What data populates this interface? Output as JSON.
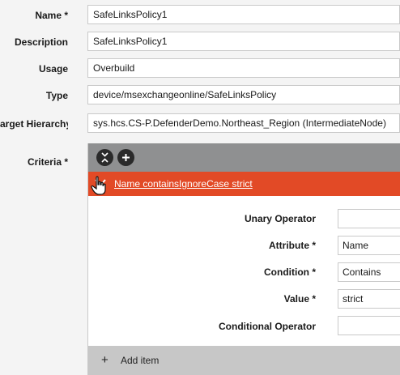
{
  "form": {
    "name": {
      "label": "Name *",
      "value": "SafeLinksPolicy1"
    },
    "description": {
      "label": "Description",
      "value": "SafeLinksPolicy1"
    },
    "usage": {
      "label": "Usage",
      "value": "Overbuild"
    },
    "type": {
      "label": "Type",
      "value": "device/msexchangeonline/SafeLinksPolicy"
    },
    "target_hierarchy": {
      "label": "arget Hierarchy",
      "value": "sys.hcs.CS-P.DefenderDemo.Northeast_Region (IntermediateNode)"
    },
    "criteria_label": "Criteria *"
  },
  "criteria": {
    "rule_text": "Name containsIgnoreCase strict",
    "fields": {
      "unary_operator": {
        "label": "Unary Operator",
        "value": ""
      },
      "attribute": {
        "label": "Attribute *",
        "value": "Name"
      },
      "condition": {
        "label": "Condition *",
        "value": "Contains"
      },
      "value": {
        "label": "Value *",
        "value": "strict"
      },
      "conditional_operator": {
        "label": "Conditional Operator",
        "value": ""
      }
    },
    "add_item_label": "Add item"
  },
  "colors": {
    "rule_bar": "#e24a26",
    "toolbar": "#8f9091",
    "add_bar": "#c7c7c7"
  },
  "icons": {
    "collapse_all": "collapse-all-icon",
    "add": "plus-icon",
    "rule_toggle": "chevron-down-icon",
    "pointer": "hand-cursor-icon",
    "add_item": "plus-icon"
  }
}
